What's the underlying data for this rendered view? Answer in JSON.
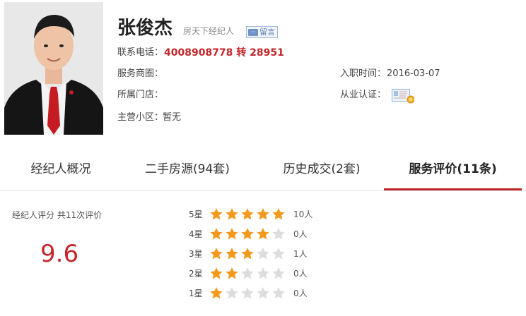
{
  "agent": {
    "name": "张俊杰",
    "role": "房天下经纪人",
    "message_label": "留言",
    "phone_label": "联系电话：",
    "phone": "4008908778 转 28951",
    "business_circle_label": "服务商圈：",
    "store_label": "所属门店：",
    "community_label": "主营小区：",
    "community_value": "暂无",
    "join_label": "入职时间：",
    "join_value": "2016-03-07",
    "cert_label": "从业认证："
  },
  "tabs": [
    {
      "label": "经纪人概况"
    },
    {
      "label": "二手房源(94套)"
    },
    {
      "label": "历史成交(2套)"
    },
    {
      "label": "服务评价(11条)",
      "active": true
    }
  ],
  "rating": {
    "summary_label": "经纪人评分 共11次评价",
    "score": "9.6",
    "rows": [
      {
        "label": "5星",
        "stars": 5,
        "count": "10人"
      },
      {
        "label": "4星",
        "stars": 4,
        "count": "0人"
      },
      {
        "label": "3星",
        "stars": 3,
        "count": "1人"
      },
      {
        "label": "2星",
        "stars": 2,
        "count": "0人"
      },
      {
        "label": "1星",
        "stars": 1,
        "count": "0人"
      }
    ]
  },
  "colors": {
    "accent": "#c3252a",
    "star_on": "#f39a1e",
    "star_off": "#dddddd"
  }
}
